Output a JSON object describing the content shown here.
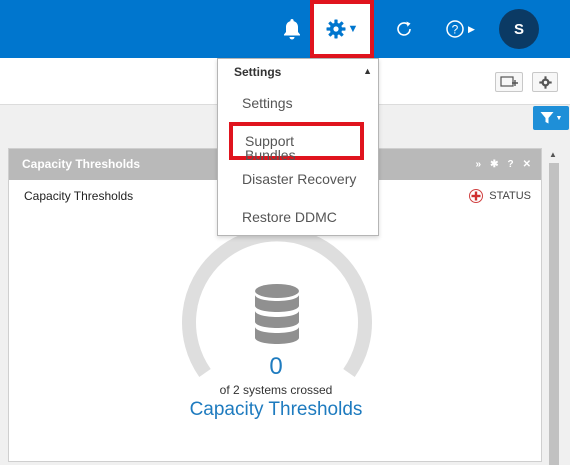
{
  "topbar": {
    "avatar_initial": "S",
    "icons": {
      "notifications": "bell-icon",
      "settings": "gear-icon",
      "refresh": "refresh-icon",
      "help": "help-icon"
    },
    "brand_color": "#0076ce"
  },
  "settings_menu": {
    "header": "Settings",
    "items": [
      {
        "label": "Settings"
      },
      {
        "label": "Support Bundles",
        "highlighted": true
      },
      {
        "label": "Disaster Recovery"
      },
      {
        "label": "Restore DDMC"
      }
    ]
  },
  "panel": {
    "header_title": "Capacity Thresholds",
    "title": "Capacity Thresholds",
    "status_label": "STATUS",
    "count": "0",
    "subtext": "of 2 systems crossed",
    "footer_label": "Capacity Thresholds",
    "accent_color": "#1e7bbf"
  }
}
